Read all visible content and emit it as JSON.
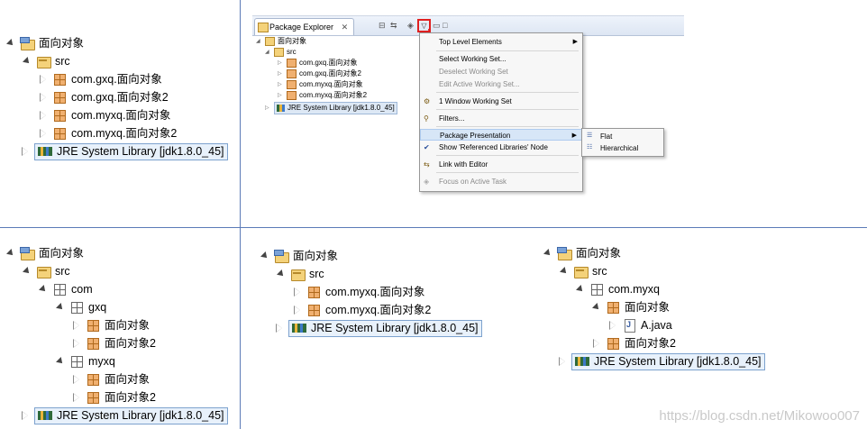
{
  "panel_top_left": {
    "project": "面向对象",
    "src": "src",
    "packages": [
      "com.gxq.面向对象",
      "com.gxq.面向对象2",
      "com.myxq.面向对象",
      "com.myxq.面向对象2"
    ],
    "library": "JRE System Library [jdk1.8.0_45]"
  },
  "eclipse": {
    "tab_label": "Package Explorer",
    "tab_close": "✕",
    "tree": {
      "project": "面向对象",
      "src": "src",
      "packages": [
        "com.gxq.面向对象",
        "com.gxq.面向对象2",
        "com.myxq.面向对象",
        "com.myxq.面向对象2"
      ],
      "library": "JRE System Library [jdk1.8.0_45]"
    },
    "menu": {
      "top_level": "Top Level Elements",
      "select_ws": "Select Working Set...",
      "deselect_ws": "Deselect Working Set",
      "edit_ws": "Edit Active Working Set...",
      "window_ws": "1 Window Working Set",
      "filters": "Filters...",
      "package_presentation": "Package Presentation",
      "show_ref": "Show 'Referenced Libraries' Node",
      "link_editor": "Link with Editor",
      "focus_task": "Focus on Active Task"
    },
    "submenu": {
      "flat": "Flat",
      "hierarchical": "Hierarchical"
    }
  },
  "panel_bottom_left": {
    "project": "面向对象",
    "src": "src",
    "com": "com",
    "gxq": "gxq",
    "gxq_children": [
      "面向对象",
      "面向对象2"
    ],
    "myxq": "myxq",
    "myxq_children": [
      "面向对象",
      "面向对象2"
    ],
    "library": "JRE System Library [jdk1.8.0_45]"
  },
  "panel_bottom_mid": {
    "project": "面向对象",
    "src": "src",
    "packages": [
      "com.myxq.面向对象",
      "com.myxq.面向对象2"
    ],
    "library": "JRE System Library [jdk1.8.0_45]"
  },
  "panel_bottom_right": {
    "project": "面向对象",
    "src": "src",
    "pkg": "com.myxq",
    "sub1": "面向对象",
    "file": "A.java",
    "sub2": "面向对象2",
    "library": "JRE System Library [jdk1.8.0_45]"
  },
  "watermark": "https://blog.csdn.net/Mikowoo007",
  "colors": {
    "grid_line": "#5b7bb7",
    "selection_border": "#7da2ce",
    "menu_highlight": "#d7e6f7",
    "arrow_red": "#e02020"
  }
}
